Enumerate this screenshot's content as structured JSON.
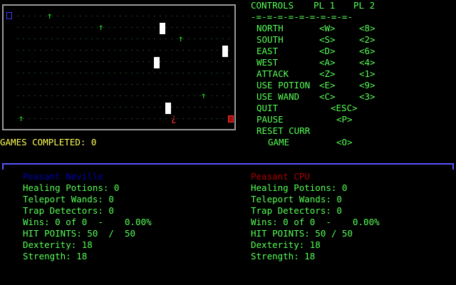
{
  "arena": {
    "row_count": 9,
    "arrows": [
      "↑",
      "↑",
      "↑",
      "↑",
      "↑"
    ]
  },
  "controls": {
    "title": "CONTROLS",
    "pl1_header": "PL 1",
    "pl2_header": "PL 2",
    "separator": "-=-=-=-=-=-=-=-=-=-",
    "rows": [
      {
        "label": "NORTH",
        "pl1": "<W>",
        "pl2": "<8>"
      },
      {
        "label": "SOUTH",
        "pl1": "<S>",
        "pl2": "<2>"
      },
      {
        "label": "EAST",
        "pl1": "<D>",
        "pl2": "<6>"
      },
      {
        "label": "WEST",
        "pl1": "<A>",
        "pl2": "<4>"
      },
      {
        "label": "ATTACK",
        "pl1": "<Z>",
        "pl2": "<1>"
      },
      {
        "label": "USE POTION",
        "pl1": "<E>",
        "pl2": "<9>"
      },
      {
        "label": "USE WAND",
        "pl1": "<C>",
        "pl2": "<3>"
      }
    ],
    "quit_label": "QUIT",
    "quit_key": "<ESC>",
    "pause_label": "PAUSE",
    "pause_key": "<P>",
    "reset_label_1": "RESET CURR",
    "reset_label_2": "GAME",
    "reset_key": "<O>"
  },
  "games_completed": "GAMES COMPLETED: 0",
  "player1": {
    "name": "Peasant Neville",
    "healing": "Healing Potions: 0",
    "teleport": "Teleport Wands: 0",
    "trap": "Trap Detectors: 0",
    "wins": "Wins: 0 of 0  -    0.00%",
    "hp": "HIT POINTS: 50  /  50",
    "dex": "Dexterity: 18",
    "str": "Strength: 18"
  },
  "player2": {
    "name": "Peasant CPU",
    "healing": "Healing Potions: 0",
    "teleport": "Teleport Wands: 0",
    "trap": "Trap Detectors: 0",
    "wins": "Wins: 0 of 0  -    0.00%",
    "hp": "HIT POINTS: 50 / 50",
    "dex": "Dexterity: 18",
    "str": "Strength: 18"
  },
  "colors": {
    "green": "#55ff55",
    "yellow": "#ffff55",
    "p1": "#0000aa",
    "p2": "#aa0000",
    "divider": "#5555ff"
  }
}
